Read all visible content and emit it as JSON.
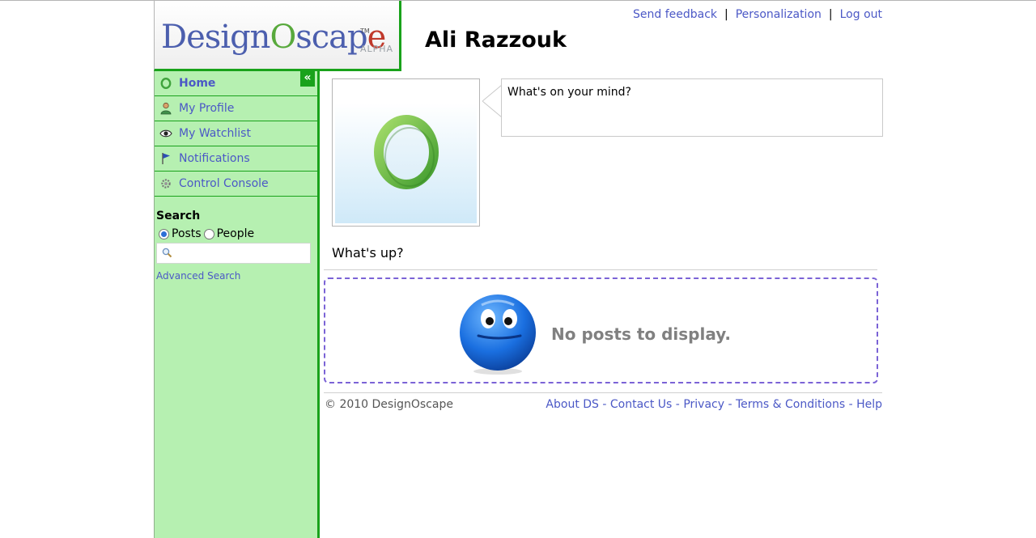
{
  "header": {
    "logo_text": "DesignOscape",
    "logo_tm": "TM",
    "logo_badge": "ALPHA",
    "user_name": "Ali Razzouk",
    "links": [
      {
        "label": "Send feedback"
      },
      {
        "label": "Personalization"
      },
      {
        "label": "Log out"
      }
    ],
    "separator": "|"
  },
  "sidebar": {
    "collapse_label": "«",
    "items": [
      {
        "label": "Home",
        "icon": "o-logo-icon",
        "active": true
      },
      {
        "label": "My Profile",
        "icon": "person-icon"
      },
      {
        "label": "My Watchlist",
        "icon": "eye-icon"
      },
      {
        "label": "Notifications",
        "icon": "flag-icon"
      },
      {
        "label": "Control Console",
        "icon": "gear-icon"
      }
    ],
    "search": {
      "title": "Search",
      "options": [
        {
          "label": "Posts",
          "checked": true
        },
        {
          "label": "People",
          "checked": false
        }
      ],
      "placeholder": "",
      "advanced_label": "Advanced Search"
    }
  },
  "main": {
    "status_placeholder": "What's on your mind?",
    "feed_title": "What's up?",
    "empty_message": "No posts to display."
  },
  "footer": {
    "copyright": "© 2010 DesignOscape",
    "links": [
      {
        "label": "About DS"
      },
      {
        "label": "Contact Us"
      },
      {
        "label": "Privacy"
      },
      {
        "label": "Terms & Conditions"
      },
      {
        "label": "Help"
      }
    ],
    "separator": " - "
  },
  "colors": {
    "sidebar_bg": "#b6f0b1",
    "accent_green": "#19a21b",
    "link_blue": "#4b58c6",
    "dashed_purple": "#7b63d6"
  }
}
